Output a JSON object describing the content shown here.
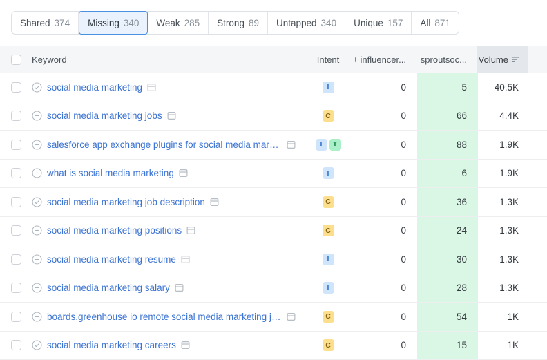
{
  "tabs": [
    {
      "label": "Shared",
      "count": "374",
      "active": false
    },
    {
      "label": "Missing",
      "count": "340",
      "active": true
    },
    {
      "label": "Weak",
      "count": "285",
      "active": false
    },
    {
      "label": "Strong",
      "count": "89",
      "active": false
    },
    {
      "label": "Untapped",
      "count": "340",
      "active": false
    },
    {
      "label": "Unique",
      "count": "157",
      "active": false
    },
    {
      "label": "All",
      "count": "871",
      "active": false
    }
  ],
  "table": {
    "headers": {
      "keyword": "Keyword",
      "intent": "Intent",
      "competitor1": "influencer...",
      "competitor1_color": "#1ca7ec",
      "competitor2": "sproutsoc...",
      "competitor2_color": "#4ddb96",
      "volume": "Volume"
    },
    "highlight_color": "#d9f7e4",
    "rows": [
      {
        "status": "check",
        "keyword": "social media marketing",
        "intents": [
          "I"
        ],
        "competitor1": "0",
        "competitor2": "5",
        "volume": "40.5K"
      },
      {
        "status": "plus",
        "keyword": "social media marketing jobs",
        "intents": [
          "C"
        ],
        "competitor1": "0",
        "competitor2": "66",
        "volume": "4.4K"
      },
      {
        "status": "plus",
        "keyword": "salesforce app exchange plugins for social media marketing",
        "intents": [
          "I",
          "T"
        ],
        "competitor1": "0",
        "competitor2": "88",
        "volume": "1.9K"
      },
      {
        "status": "plus",
        "keyword": "what is social media marketing",
        "intents": [
          "I"
        ],
        "competitor1": "0",
        "competitor2": "6",
        "volume": "1.9K"
      },
      {
        "status": "check",
        "keyword": "social media marketing job description",
        "intents": [
          "C"
        ],
        "competitor1": "0",
        "competitor2": "36",
        "volume": "1.3K"
      },
      {
        "status": "plus",
        "keyword": "social media marketing positions",
        "intents": [
          "C"
        ],
        "competitor1": "0",
        "competitor2": "24",
        "volume": "1.3K"
      },
      {
        "status": "plus",
        "keyword": "social media marketing resume",
        "intents": [
          "I"
        ],
        "competitor1": "0",
        "competitor2": "30",
        "volume": "1.3K"
      },
      {
        "status": "plus",
        "keyword": "social media marketing salary",
        "intents": [
          "I"
        ],
        "competitor1": "0",
        "competitor2": "28",
        "volume": "1.3K"
      },
      {
        "status": "plus",
        "keyword": "boards.greenhouse io remote social media marketing jobs",
        "intents": [
          "C"
        ],
        "competitor1": "0",
        "competitor2": "54",
        "volume": "1K"
      },
      {
        "status": "check",
        "keyword": "social media marketing careers",
        "intents": [
          "C"
        ],
        "competitor1": "0",
        "competitor2": "15",
        "volume": "1K"
      }
    ]
  }
}
